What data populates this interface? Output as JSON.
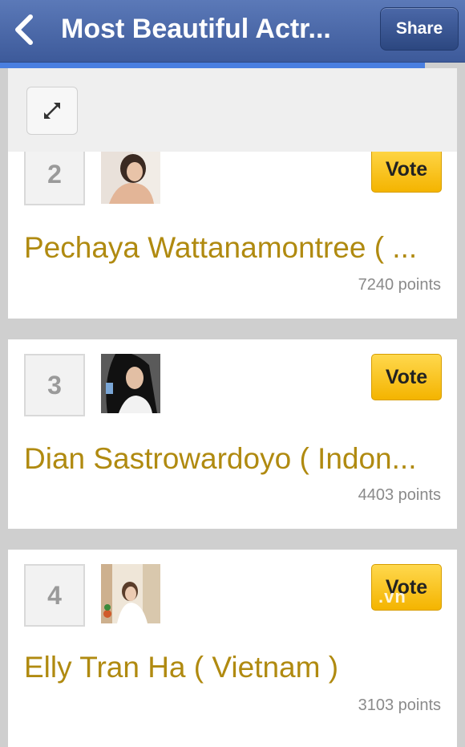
{
  "header": {
    "title": "Most Beautiful Actr...",
    "share_label": "Share"
  },
  "colors": {
    "nav_bar": "#4a67a8",
    "vote_button": "#f9c41a",
    "name_text": "#b08a10"
  },
  "icons": {
    "back": "chevron-left-icon",
    "expand": "expand-arrows-icon"
  },
  "entries": [
    {
      "rank": "2",
      "name": "Pechaya Wattanamontree ( ...",
      "points": "7240 points",
      "vote_label": "Vote"
    },
    {
      "rank": "3",
      "name": "Dian Sastrowardoyo ( Indon...",
      "points": "4403 points",
      "vote_label": "Vote"
    },
    {
      "rank": "4",
      "name": "Elly Tran Ha ( Vietnam )",
      "points": "3103 points",
      "vote_label": "Vote"
    }
  ],
  "watermark": ".vn"
}
